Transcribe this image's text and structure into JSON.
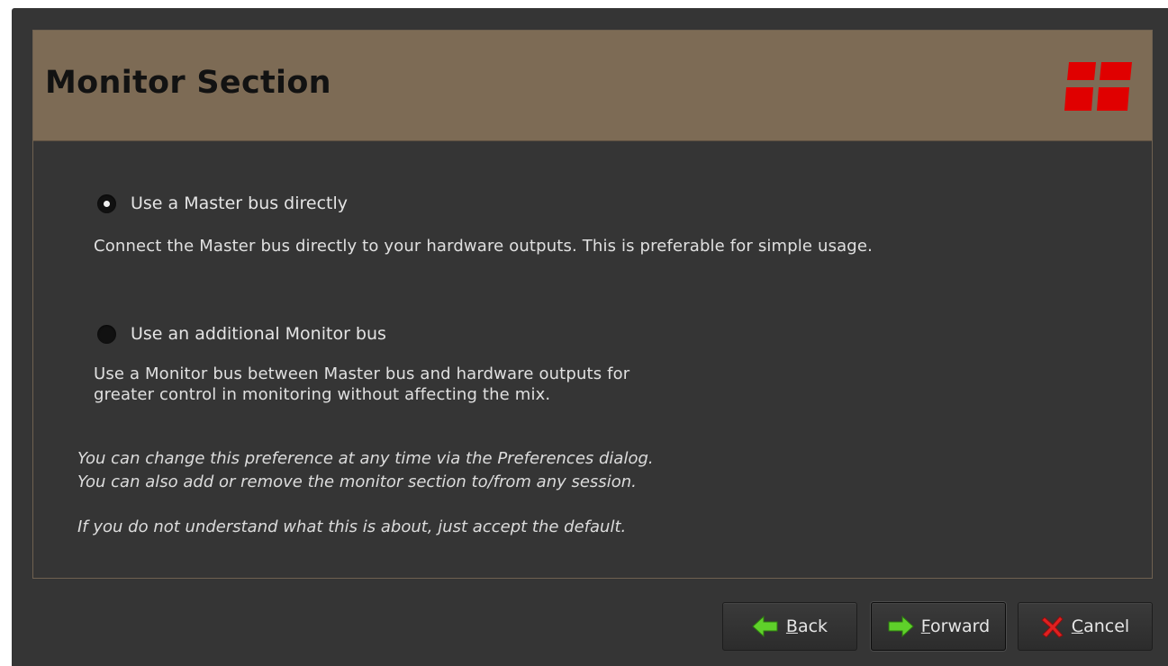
{
  "header": {
    "title": "Monitor Section",
    "logo_color": "#e00000",
    "background": "#7d6b55"
  },
  "options": [
    {
      "label": "Use a Master bus directly",
      "checked": true,
      "description": "Connect the Master bus directly to your hardware outputs. This is preferable for simple usage."
    },
    {
      "label": "Use an additional Monitor bus",
      "checked": false,
      "description": "Use a Monitor bus between Master bus and hardware outputs for\ngreater control in monitoring without affecting the mix."
    }
  ],
  "notes": {
    "preference": "You can change this preference at any time via the Preferences dialog.\nYou can also add or remove the monitor section to/from any session.",
    "default_hint": "If you do not understand what this is about, just accept the default."
  },
  "buttons": {
    "back": {
      "mnemonic": "B",
      "rest": "ack",
      "icon": "arrow-left-icon"
    },
    "forward": {
      "mnemonic": "F",
      "rest": "orward",
      "icon": "arrow-right-icon"
    },
    "cancel": {
      "mnemonic": "C",
      "rest": "ancel",
      "icon": "cancel-x-icon"
    }
  },
  "colors": {
    "window_bg": "#353535",
    "arrow_green": "#5fd12a",
    "cancel_red": "#e02020"
  }
}
